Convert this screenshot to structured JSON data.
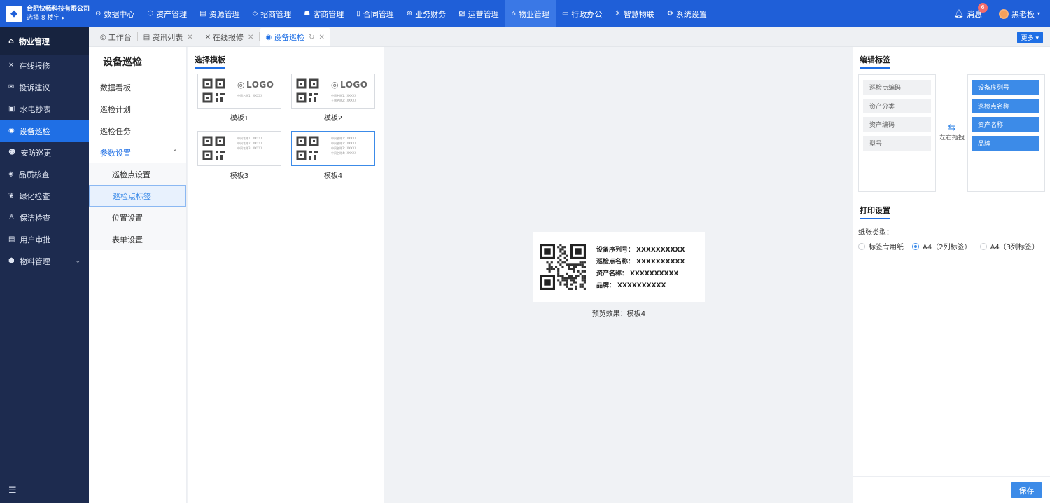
{
  "brand": {
    "name": "合肥快畅科技有限公司",
    "sub": "选择 8 楼宇 ▸"
  },
  "topnav": [
    {
      "label": "数据中心",
      "icon": "clock-icon",
      "glyph": "⊙"
    },
    {
      "label": "资产管理",
      "icon": "cube-icon",
      "glyph": "⬡"
    },
    {
      "label": "资源管理",
      "icon": "building-icon",
      "glyph": "▤"
    },
    {
      "label": "招商管理",
      "icon": "tag-icon",
      "glyph": "◇"
    },
    {
      "label": "客商管理",
      "icon": "people-icon",
      "glyph": "☗"
    },
    {
      "label": "合同管理",
      "icon": "document-icon",
      "glyph": "▯"
    },
    {
      "label": "业务财务",
      "icon": "coin-icon",
      "glyph": "⊚"
    },
    {
      "label": "运营管理",
      "icon": "chart-icon",
      "glyph": "▨"
    },
    {
      "label": "物业管理",
      "icon": "home-icon",
      "glyph": "⌂"
    },
    {
      "label": "行政办公",
      "icon": "monitor-icon",
      "glyph": "▭"
    },
    {
      "label": "智慧物联",
      "icon": "sensor-icon",
      "glyph": "✳"
    },
    {
      "label": "系统设置",
      "icon": "gear-icon",
      "glyph": "⚙"
    }
  ],
  "header": {
    "messages": "消息",
    "badge": "6",
    "user": "黑老板"
  },
  "sidebar": {
    "title": "物业管理",
    "items": [
      {
        "label": "在线报修",
        "icon": "tools-icon",
        "glyph": "✕"
      },
      {
        "label": "投诉建议",
        "icon": "mail-icon",
        "glyph": "✉"
      },
      {
        "label": "水电抄表",
        "icon": "meter-icon",
        "glyph": "▣"
      },
      {
        "label": "设备巡检",
        "icon": "location-icon",
        "glyph": "◉"
      },
      {
        "label": "安防巡更",
        "icon": "guard-icon",
        "glyph": "☻"
      },
      {
        "label": "品质核查",
        "icon": "shield-icon",
        "glyph": "◈"
      },
      {
        "label": "绿化检查",
        "icon": "plant-icon",
        "glyph": "❦"
      },
      {
        "label": "保洁检查",
        "icon": "broom-icon",
        "glyph": "♙"
      },
      {
        "label": "用户审批",
        "icon": "approve-icon",
        "glyph": "▤"
      },
      {
        "label": "物料管理",
        "icon": "box-icon",
        "glyph": "⬢"
      }
    ]
  },
  "tabs": [
    {
      "label": "工作台",
      "icon": "dashboard-icon",
      "glyph": "◎"
    },
    {
      "label": "资讯列表",
      "icon": "list-icon",
      "glyph": "▤"
    },
    {
      "label": "在线报修",
      "icon": "tools-icon",
      "glyph": "✕"
    },
    {
      "label": "设备巡检",
      "icon": "location-icon",
      "glyph": "◉"
    }
  ],
  "more_label": "更多",
  "submenu": {
    "title": "设备巡检",
    "items": [
      "数据看板",
      "巡检计划",
      "巡检任务"
    ],
    "group": "参数设置",
    "subitems": [
      "巡检点设置",
      "巡检点标签",
      "位置设置",
      "表单设置"
    ]
  },
  "templates": {
    "title": "选择模板",
    "logo_text": "LOGO",
    "cards": [
      {
        "label": "模板1",
        "lines": [
          "中间名称1：XXXXX"
        ]
      },
      {
        "label": "模板2",
        "lines": [
          "中间名称1：XXXXX",
          "王牌名称2：XXXXX"
        ]
      },
      {
        "label": "模板3",
        "lines": [
          "中间名称1：XXXXX",
          "中间名称2：XXXXX",
          "中间名称3：XXXXX"
        ]
      },
      {
        "label": "模板4",
        "lines": [
          "中间名称1：XXXXX",
          "中间名称2：XXXXX",
          "中间名称3：XXXXX",
          "中间名称4：XXXXX"
        ]
      }
    ]
  },
  "preview": {
    "rows": [
      {
        "label": "设备序列号：",
        "value": "XXXXXXXXXX"
      },
      {
        "label": "巡检点名称：",
        "value": "XXXXXXXXXX"
      },
      {
        "label": "资产名称：",
        "value": "XXXXXXXXXX"
      },
      {
        "label": "品牌：",
        "value": "XXXXXXXXXX"
      }
    ],
    "caption": "预览效果：模板4"
  },
  "edit_tags": {
    "title": "编辑标签",
    "available": [
      "巡检点编码",
      "资产分类",
      "资产编码",
      "型号"
    ],
    "selected": [
      "设备序列号",
      "巡检点名称",
      "资产名称",
      "品牌"
    ],
    "swap_label": "左右拖拽"
  },
  "print": {
    "title": "打印设置",
    "paper_label": "纸张类型：",
    "options": [
      "标签专用纸",
      "A4（2列标签）",
      "A4（3列标签）"
    ],
    "selected": "A4（2列标签）"
  },
  "save_label": "保存"
}
